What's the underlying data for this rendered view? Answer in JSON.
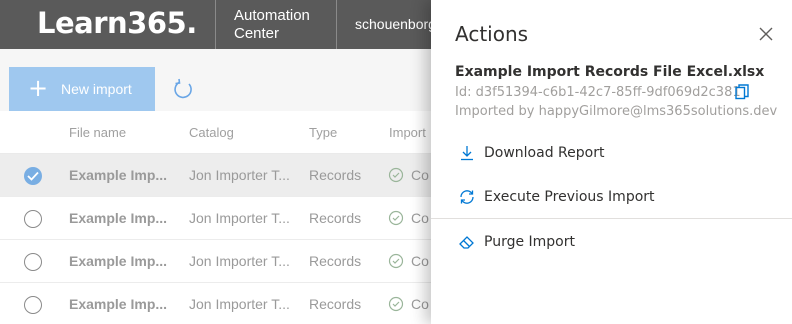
{
  "header": {
    "brand": "Learn365.",
    "app_line1": "Automation",
    "app_line2": "Center",
    "user": "schouenborg"
  },
  "toolbar": {
    "new_import_label": "New import",
    "refresh_icon": "refresh-icon",
    "plus_icon": "plus-icon"
  },
  "grid": {
    "columns": [
      "File name",
      "Catalog",
      "Type",
      "Import"
    ],
    "rows": [
      {
        "file": "Example Imp...",
        "catalog": "Jon Importer T...",
        "type": "Records",
        "status": "Co",
        "selected": true
      },
      {
        "file": "Example Imp...",
        "catalog": "Jon Importer T...",
        "type": "Records",
        "status": "Co",
        "selected": false
      },
      {
        "file": "Example Imp...",
        "catalog": "Jon Importer T...",
        "type": "Records",
        "status": "Co",
        "selected": false
      },
      {
        "file": "Example Imp...",
        "catalog": "Jon Importer T...",
        "type": "Records",
        "status": "Co",
        "selected": false
      }
    ]
  },
  "panel": {
    "title": "Actions",
    "file_name": "Example Import Records File Excel.xlsx",
    "id_text": "Id: d3f51394-c6b1-42c7-85ff-9df069d2c381",
    "imported_by": "Imported by happyGilmore@lms365solutions.dev",
    "actions": [
      {
        "label": "Download Report",
        "icon": "download-icon"
      },
      {
        "label": "Execute Previous Import",
        "icon": "sync-icon"
      },
      {
        "label": "Purge Import",
        "icon": "eraser-icon"
      }
    ]
  },
  "colors": {
    "header_bg": "#5a5a5a",
    "accent": "#0078d4",
    "button_bg": "#9fc8ef",
    "selected_row": "#ededed"
  }
}
